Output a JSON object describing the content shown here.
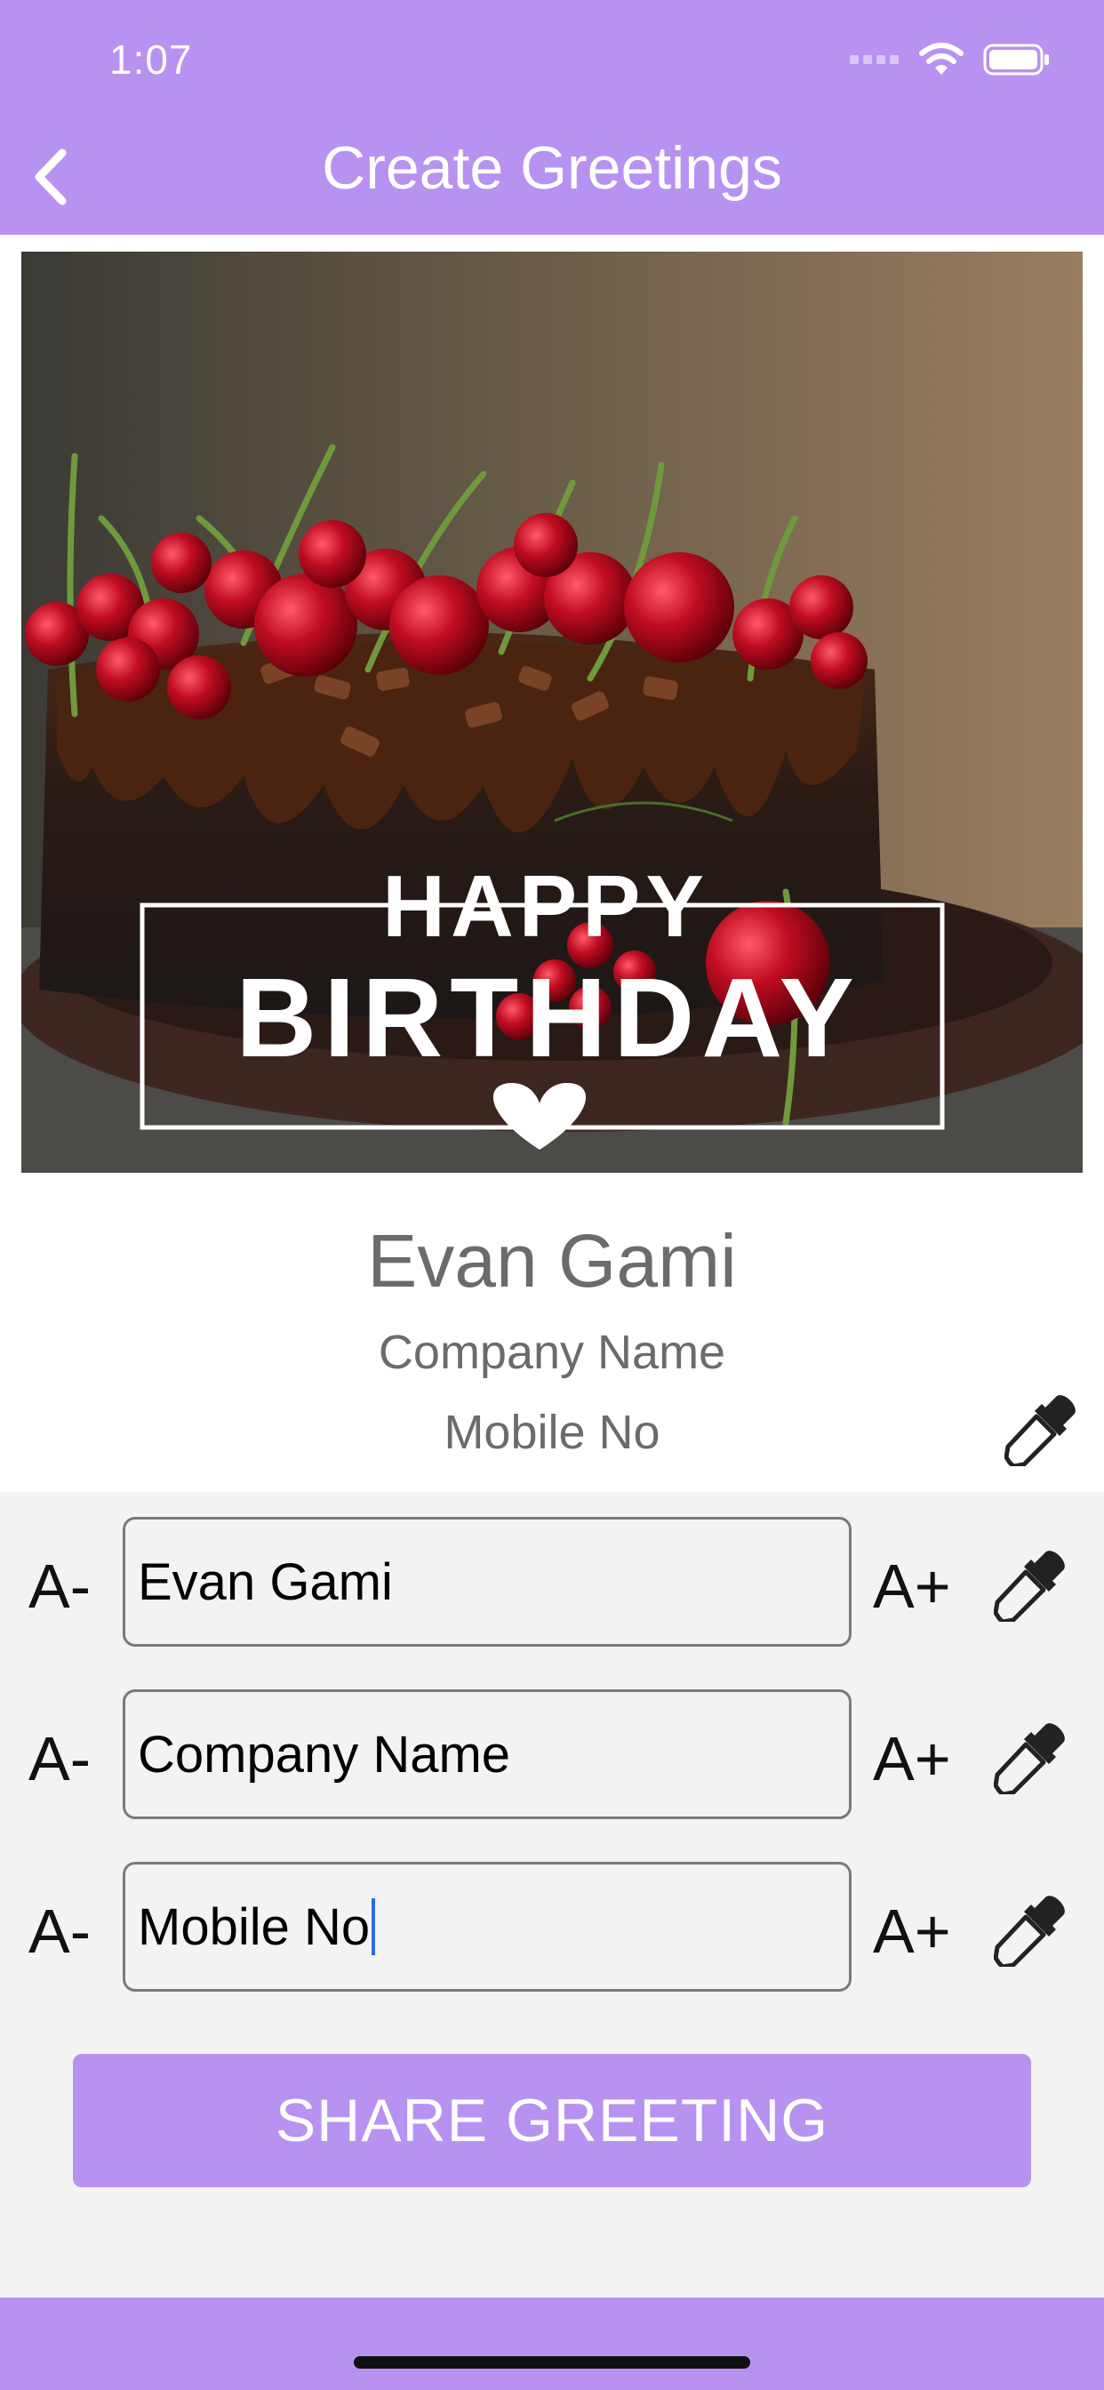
{
  "status_bar": {
    "time": "1:07"
  },
  "header": {
    "title": "Create Greetings"
  },
  "card": {
    "banner_top": "HAPPY",
    "banner_main": "BIRTHDAY",
    "name": "Evan Gami",
    "company": "Company Name",
    "mobile": "Mobile No"
  },
  "fields": [
    {
      "minus": "A-",
      "value": "Evan Gami",
      "plus": "A+"
    },
    {
      "minus": "A-",
      "value": "Company Name",
      "plus": "A+"
    },
    {
      "minus": "A-",
      "value": "Mobile No",
      "plus": "A+"
    }
  ],
  "share_button": {
    "label": "SHARE GREETING"
  },
  "colors": {
    "accent": "#b792f0",
    "panel": "#f3f3f3",
    "text_gray": "#6b6b6b"
  },
  "icons": [
    "back-chevron-icon",
    "signal-icon",
    "wifi-icon",
    "battery-icon",
    "eyedropper-icon"
  ]
}
